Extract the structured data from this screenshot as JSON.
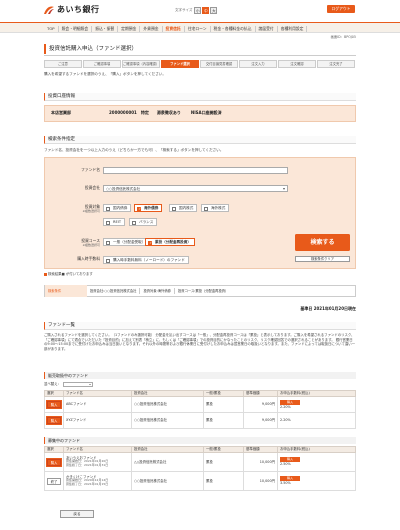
{
  "header": {
    "bank_name": "あいち銀行",
    "fontsize_label": "文字サイズ",
    "fontsize_small": "小",
    "fontsize_medium": "中",
    "fontsize_large": "大",
    "logout_label": "ログアウト",
    "brand_color": "#e85a1a"
  },
  "nav": {
    "items": [
      "TOP",
      "照会・明細照会",
      "振込・振替",
      "定期預金",
      "外貨預金",
      "投資信託",
      "住宅ローン",
      "税金・各種料金の払込",
      "諸届受付",
      "各種利用設定"
    ]
  },
  "screen_id": "画面ID：BPOJ05",
  "page_title": "投資信託購入申込（ファンド選択）",
  "steps": [
    "ご注意",
    "ご確認事項",
    "ご確認事項（內容確認）",
    "ファンド選択",
    "交付目論見書確認",
    "注文入力",
    "注文確認",
    "注文完了"
  ],
  "intro": "購入を希望するファンドを選択のうえ、「購入」ボタンを押してください。",
  "account": {
    "section_title": "投資口座情報",
    "branch": "本店営業部",
    "number": "2000000001",
    "type": "特定",
    "withholding": "源泉徴収あり",
    "nisa": "NISA口座開設済"
  },
  "search": {
    "section_title": "検索条件指定",
    "desc": "ファンド名、投資会社を一つ以上入力のうえ（どちらか一方でも可）、「検索する」ボタンを押してください。",
    "fund_name_label": "ファンド名",
    "fund_name_value": "",
    "company_label": "投資会社",
    "company_value": "○○投資信託株式会社",
    "target_label": "投資対象",
    "target_note": "※複数選択可",
    "targets": [
      {
        "label": "国内債券",
        "checked": false
      },
      {
        "label": "海外債券",
        "checked": true
      },
      {
        "label": "国内株式",
        "checked": false
      },
      {
        "label": "海外株式",
        "checked": false
      },
      {
        "label": "REIT",
        "checked": false
      },
      {
        "label": "バランス",
        "checked": false
      }
    ],
    "course_label": "投資コース",
    "course_note": "※複数選択可",
    "courses": [
      {
        "label": "一般（分配金受取）",
        "checked": false
      },
      {
        "label": "累投（分配金再投資）",
        "checked": true
      }
    ],
    "nl_label": "購入時手数料",
    "nl_option": {
      "label": "購入時手数料無料（ノーロード）のファンド",
      "checked": false
    },
    "search_button": "検索する",
    "clear_button": "検索条件クリア"
  },
  "required_note": "検索結果■ が付いております",
  "conditions": {
    "key": "検索条件",
    "values": [
      "投資会社:○○投資信託株式会社",
      "投資対象:海外債券",
      "投資コース:累投（分配金再投資）"
    ]
  },
  "base_date": "基準日 2021年01月20日現在",
  "fund_list": {
    "section_title": "ファンド一覧",
    "desc": "ご購入されるファンドを選択してください。（1ファンドのみ選択可能） 分配金を払い出すコースは「一般」、分配金再投資コースは「累投」と表示しております。ご購入を希望されるファンドのリスク、「ご確認事項」にて適合でいただいた「投資目的」に加えて別表「積立」に、もしくは「ご確認事項」での投資目的にかなったことのリスク、リスク確認回答での選択されることがあります。 銀行営業日の9:00〜15:00までに受付けたお申込みは当日扱いとなります。それ以外の時間帯および銀行休業日に受付けしたお申込みは翌営業日の取扱いとなります。また、ファンドによっては取扱日について違い一部があります。"
  },
  "selling": {
    "title": "販売取扱中のファンド",
    "sort_label": "並べ替え：",
    "sort_value": "",
    "headers": [
      "選択",
      "ファンド名",
      "投資会社",
      "一般/累投",
      "基準価額",
      "お申込手数料(税込)"
    ],
    "rows": [
      {
        "action": "購入",
        "name": "ABCファンド",
        "company": "○○投資信託株式会社",
        "course": "累投",
        "price": "9,000円",
        "fee_label": "購入",
        "fee": "2.20%"
      },
      {
        "action": "購入",
        "name": "XYZファンド",
        "company": "○○投資信託株式会社",
        "course": "累投",
        "price": "9,000円",
        "fee_label": "",
        "fee": "2.20%"
      }
    ]
  },
  "recruiting": {
    "title": "募集中のファンド",
    "headers": [
      "選択",
      "ファンド名",
      "投資会社",
      "一般/累投",
      "基準価額",
      "お申込手数料(税込)"
    ],
    "rows": [
      {
        "action": "購入",
        "name": "あいうえおファンド",
        "sub1": "募集開始日：2021年01月20日",
        "sub2": "募集終了日：2021年01月31日",
        "company": "△△投資信託株式会社",
        "course": "累投",
        "price": "10,000円",
        "fee_label": "購入",
        "fee": "2.50%"
      },
      {
        "action": "終了",
        "name": "かきくけこファンド",
        "sub1": "募集開始日：2020年12月14日",
        "sub2": "募集終了日：2021年01月15日",
        "company": "○○投資信託株式会社",
        "course": "累投",
        "price": "10,000円",
        "fee_label": "購入",
        "fee": "3.50%"
      }
    ]
  },
  "back_button": "戻る"
}
